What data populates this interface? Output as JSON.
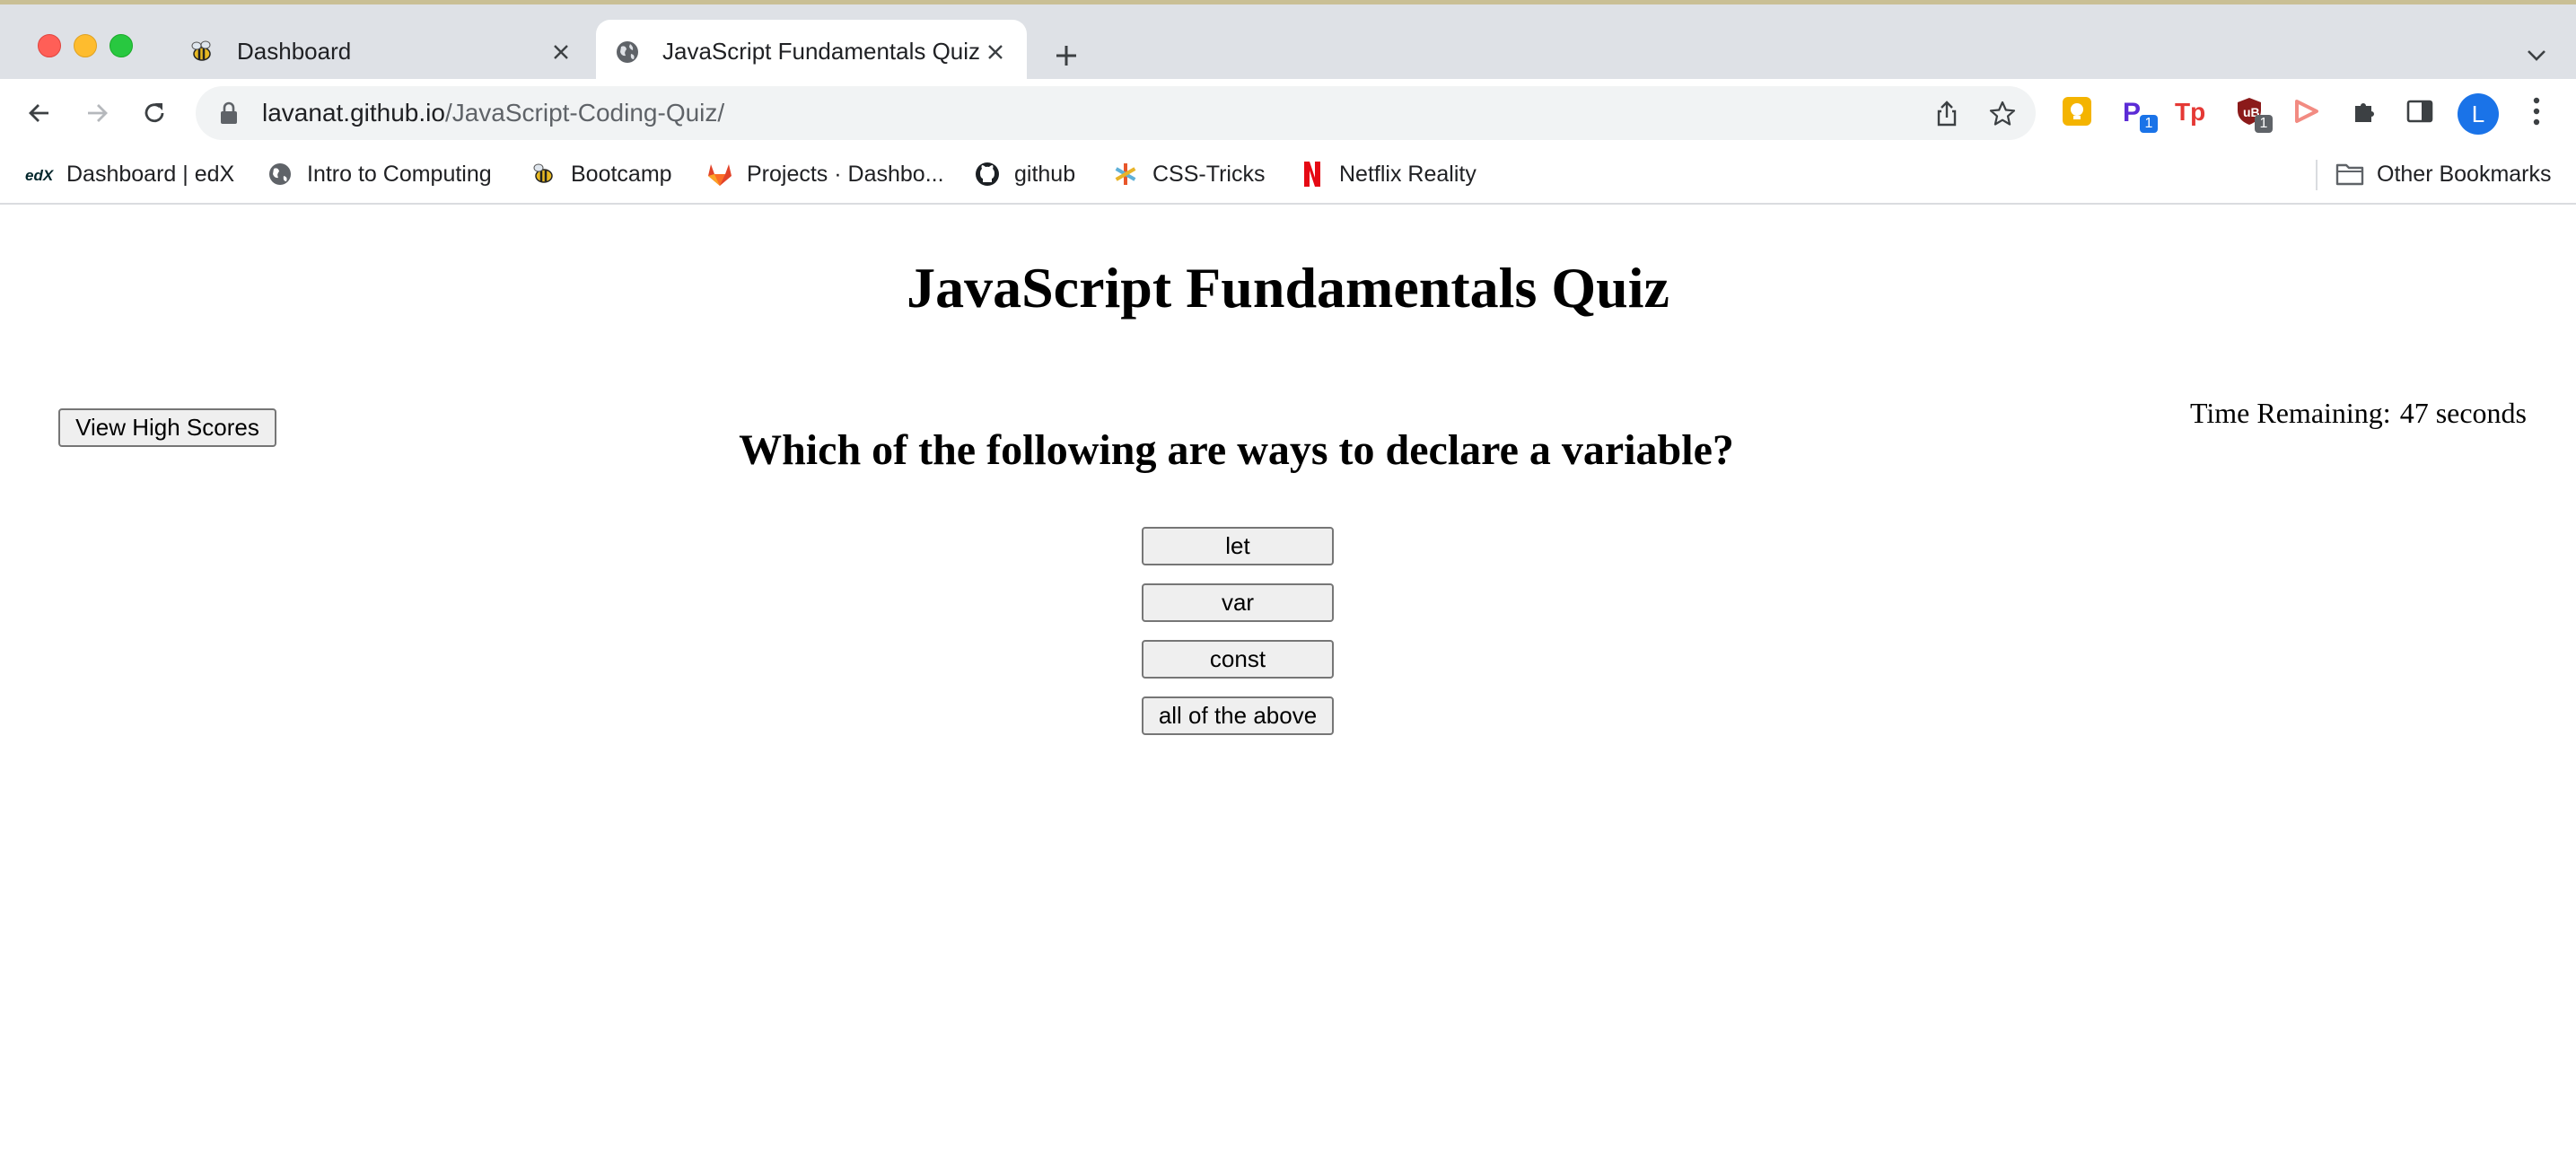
{
  "browser": {
    "tabs": [
      {
        "title": "Dashboard",
        "favicon": "bee-icon",
        "active": false
      },
      {
        "title": "JavaScript Fundamentals Quiz",
        "favicon": "globe-icon",
        "active": true
      }
    ],
    "address": {
      "host": "lavanat.github.io",
      "path": "/JavaScript-Coding-Quiz/"
    },
    "extensions": [
      {
        "name": "yellow-extension-icon",
        "badge": ""
      },
      {
        "name": "p-extension-icon",
        "badge": "1"
      },
      {
        "name": "tp-extension-icon",
        "badge": ""
      },
      {
        "name": "shield-extension-icon",
        "badge": "1"
      },
      {
        "name": "arrow-extension-icon",
        "badge": ""
      }
    ],
    "profile_initial": "L",
    "bookmarks": [
      {
        "label": "Dashboard | edX",
        "icon": "edx-icon"
      },
      {
        "label": "Intro to Computing",
        "icon": "globe-icon"
      },
      {
        "label": "Bootcamp",
        "icon": "bee-icon"
      },
      {
        "label": "Projects · Dashbo...",
        "icon": "gitlab-icon"
      },
      {
        "label": "github",
        "icon": "github-icon"
      },
      {
        "label": "CSS-Tricks",
        "icon": "asterisk-icon"
      },
      {
        "label": "Netflix Reality",
        "icon": "netflix-icon"
      }
    ],
    "other_bookmarks": "Other Bookmarks"
  },
  "quiz": {
    "title": "JavaScript Fundamentals Quiz",
    "high_scores_label": "View High Scores",
    "timer_label": "Time Remaining:",
    "timer_value": "47 seconds",
    "question": "Which of the following are ways to declare a variable?",
    "answers": [
      "let",
      "var",
      "const",
      "all of the above"
    ]
  }
}
